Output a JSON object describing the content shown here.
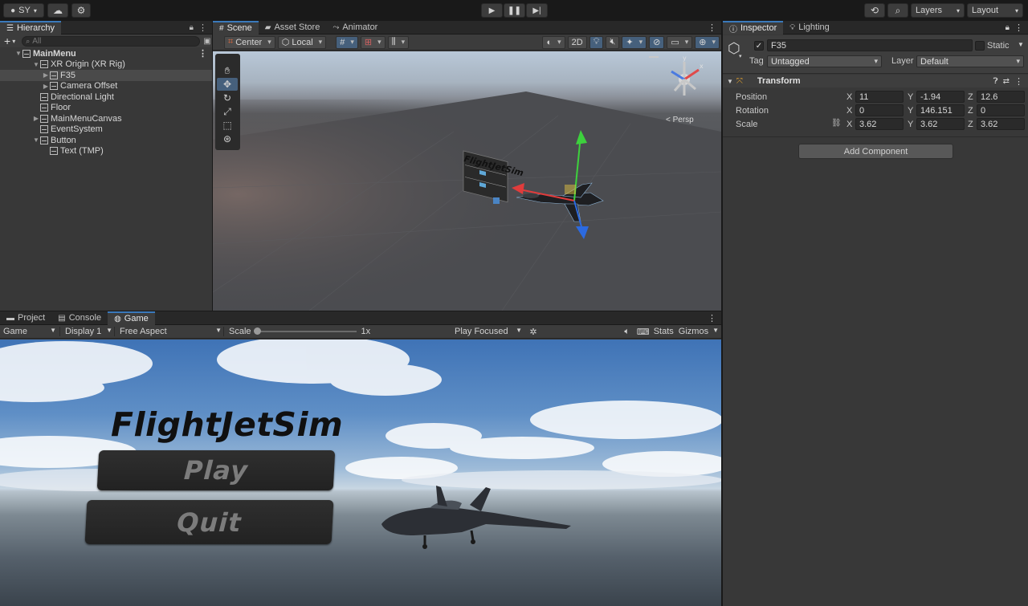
{
  "top_toolbar": {
    "account": "SY",
    "layers": "Layers",
    "layout": "Layout"
  },
  "hierarchy": {
    "tab": "Hierarchy",
    "search_placeholder": "All",
    "items": [
      {
        "label": "MainMenu",
        "depth": 0
      },
      {
        "label": "XR Origin (XR Rig)",
        "depth": 1
      },
      {
        "label": "F35",
        "depth": 2
      },
      {
        "label": "Camera Offset",
        "depth": 2
      },
      {
        "label": "Directional Light",
        "depth": 1
      },
      {
        "label": "Floor",
        "depth": 1
      },
      {
        "label": "MainMenuCanvas",
        "depth": 1
      },
      {
        "label": "EventSystem",
        "depth": 1
      },
      {
        "label": "Button",
        "depth": 1
      },
      {
        "label": "Text (TMP)",
        "depth": 2
      }
    ]
  },
  "scene": {
    "tabs": [
      "Scene",
      "Asset Store",
      "Animator"
    ],
    "pivot": "Center",
    "space": "Local",
    "mode_2d": "2D",
    "persp": "< Persp",
    "canvas_title": "FlightJetSim"
  },
  "bottom": {
    "tabs": [
      "Project",
      "Console",
      "Game"
    ],
    "game_select": "Game",
    "display": "Display 1",
    "aspect": "Free Aspect",
    "scale_label": "Scale",
    "scale_value": "1x",
    "play_mode": "Play Focused",
    "stats": "Stats",
    "gizmos": "Gizmos"
  },
  "game": {
    "title": "FlightJetSim",
    "play": "Play",
    "quit": "Quit"
  },
  "inspector": {
    "tabs": [
      "Inspector",
      "Lighting"
    ],
    "object_name": "F35",
    "static_label": "Static",
    "tag_label": "Tag",
    "tag_value": "Untagged",
    "layer_label": "Layer",
    "layer_value": "Default",
    "transform_title": "Transform",
    "rows": [
      {
        "label": "Position",
        "x": "11",
        "y": "-1.94",
        "z": "12.6"
      },
      {
        "label": "Rotation",
        "x": "0",
        "y": "146.151",
        "z": "0"
      },
      {
        "label": "Scale",
        "x": "3.62",
        "y": "3.62",
        "z": "3.62"
      }
    ],
    "axis": {
      "x": "X",
      "y": "Y",
      "z": "Z"
    },
    "add_component": "Add Component"
  },
  "colors": {
    "accent": "#3a79bb",
    "panel": "#383838",
    "toolbar": "#191919"
  }
}
